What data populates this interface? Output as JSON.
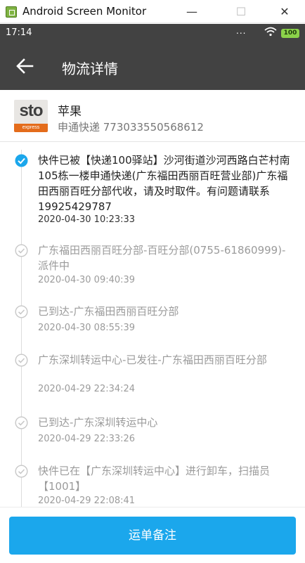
{
  "window": {
    "title": "Android Screen Monitor",
    "minimize_glyph": "—",
    "maximize_glyph": "☐",
    "close_glyph": "✕"
  },
  "status_bar": {
    "time": "17:14",
    "dots": "...",
    "battery": "100",
    "battery_color": "#8bd24a"
  },
  "app_bar": {
    "title": "物流详情",
    "back_icon": "arrow-left-icon",
    "background": "#424242"
  },
  "shipment": {
    "item_name": "苹果",
    "carrier_line": "申通快递 773033550568612",
    "logo": {
      "text": "sto",
      "tagline": "express",
      "accent": "#e46c1b"
    }
  },
  "timeline": [
    {
      "text": "快件已被【快递100驿站】沙河街道沙河西路白芒村南105栋一楼申通快递(广东福田西丽百旺营业部)广东福田西丽百旺分部代收，请及时取件。有问题请联系19925429787",
      "time": "2020-04-30 10:23:33",
      "current": true
    },
    {
      "text": "广东福田西丽百旺分部-百旺分部(0755-61860999)-派件中",
      "time": "2020-04-30 09:40:39",
      "current": false
    },
    {
      "text": "已到达-广东福田西丽百旺分部",
      "time": "2020-04-30 08:55:39",
      "current": false
    },
    {
      "text": "广东深圳转运中心-已发往-广东福田西丽百旺分部",
      "time": "2020-04-29 22:34:24",
      "current": false
    },
    {
      "text": "已到达-广东深圳转运中心",
      "time": "2020-04-29 22:33:26",
      "current": false
    },
    {
      "text": "快件已在【广东深圳转运中心】进行卸车，扫描员【1001】",
      "time": "2020-04-29 22:08:41",
      "current": false
    }
  ],
  "colors": {
    "accent_blue": "#1ba7ec",
    "done_gray": "#c8c8c8"
  },
  "bottom": {
    "note_button": "运单备注"
  }
}
